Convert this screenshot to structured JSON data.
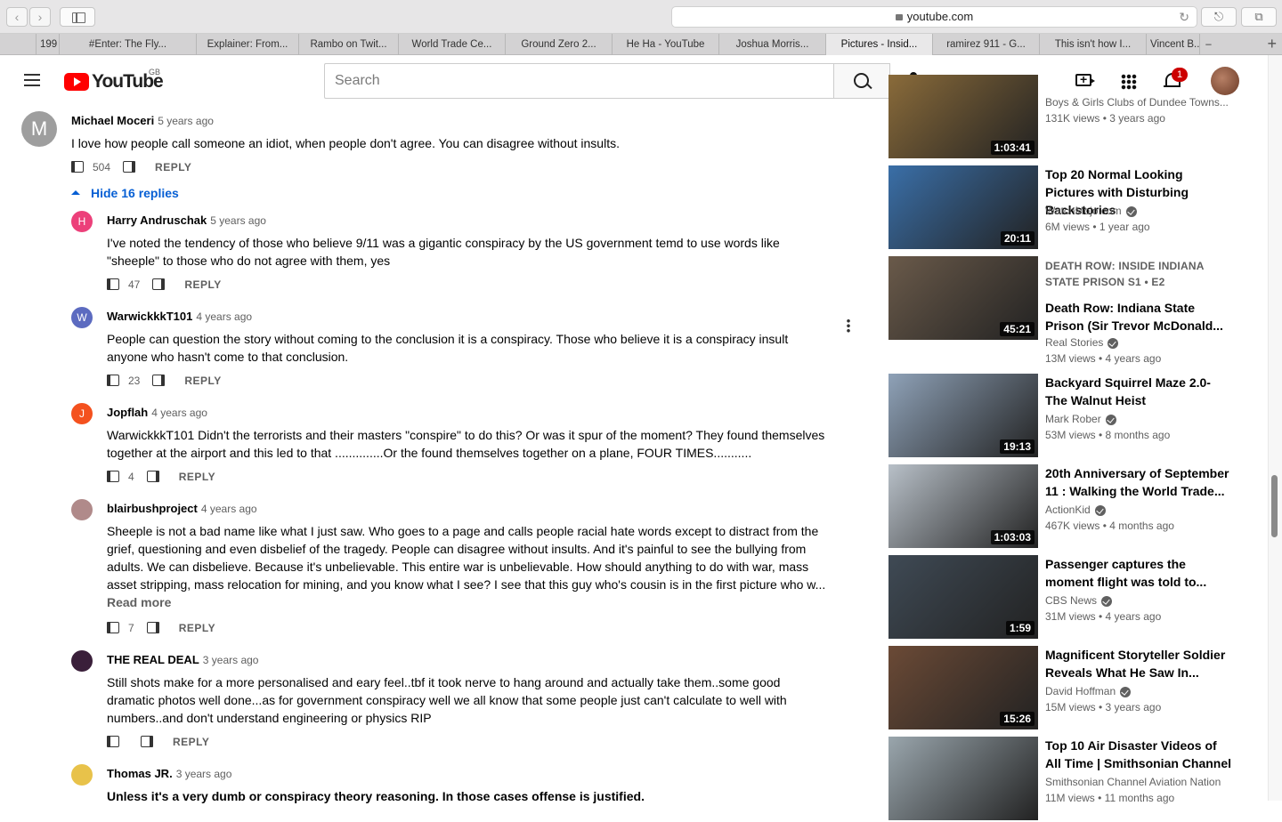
{
  "browser": {
    "url": "youtube.com",
    "tabs": [
      "199",
      "#Enter: The Fly...",
      "Explainer: From...",
      "Rambo on Twit...",
      "World Trade Ce...",
      "Ground Zero 2...",
      "He Ha - YouTube",
      "Joshua Morris...",
      "Pictures - Insid...",
      "ramirez 911 - G...",
      "This isn't how I...",
      "Vincent B...",
      "–"
    ]
  },
  "header": {
    "logo": "YouTube",
    "country": "GB",
    "search_placeholder": "Search",
    "notifications": "1"
  },
  "comments": [
    {
      "author": "Michael Moceri",
      "time": "5 years ago",
      "initial": "M",
      "avatar_color": "#9e9e9e",
      "text": "I love how people call someone an idiot, when people don't agree. You can disagree without insults.",
      "likes": "504",
      "reply": "REPLY"
    },
    {
      "author": "Harry Andruschak",
      "time": "5 years ago",
      "initial": "H",
      "avatar_color": "#ec407a",
      "text": "I've noted the tendency of those who believe 9/11 was a gigantic conspiracy by the US government temd to use words like \"sheeple\" to those who do not agree with them, yes",
      "likes": "47",
      "reply": "REPLY"
    },
    {
      "author": "WarwickkkT101",
      "time": "4 years ago",
      "initial": "W",
      "avatar_color": "#5c6bc0",
      "text": "People can question the story without coming to the conclusion it is a conspiracy. Those who believe it is a conspiracy insult anyone who hasn't come to that conclusion.",
      "likes": "23",
      "reply": "REPLY"
    },
    {
      "author": "Jopflah",
      "time": "4 years ago",
      "initial": "J",
      "avatar_color": "#f4511e",
      "text": "WarwickkkT101 Didn't the terrorists and their masters \"conspire\" to do this? Or was it spur of the moment? They found themselves together at the airport and this led to that ..............Or the found themselves together on a plane, FOUR TIMES...........",
      "likes": "4",
      "reply": "REPLY"
    },
    {
      "author": "blairbushproject",
      "time": "4 years ago",
      "initial": "",
      "avatar_color": "#b08a8a",
      "text": "Sheeple is not a bad name like what I just saw. Who goes to a page and calls people racial hate words except to distract from the grief, questioning and even disbelief of the tragedy. People can disagree without insults. And it's painful to see the bullying from adults. We can disbelieve. Because it's unbelievable. This entire war is unbelievable. How should anything to do with war, mass asset stripping, mass relocation for mining, and you know what I see?  I see that this guy who's cousin is in the first picture who w...",
      "likes": "7",
      "reply": "REPLY",
      "read_more": "Read more"
    },
    {
      "author": "THE REAL DEAL",
      "time": "3 years ago",
      "initial": "",
      "avatar_color": "#3a1f3a",
      "text": "Still shots make for a more personalised and eary feel..tbf it took nerve to hang around and actually take them..some good dramatic photos well done...as for government conspiracy well we all know that some people just can't calculate to well with numbers..and don't understand engineering or physics RIP",
      "likes": "",
      "reply": "REPLY"
    },
    {
      "author": "Thomas JR.",
      "time": "3 years ago",
      "initial": "",
      "avatar_color": "#e8c24a",
      "text": "Unless it's a very dumb or conspiracy theory reasoning. In those cases offense is justified.",
      "likes": "",
      "reply": ""
    }
  ],
  "hide_replies": "Hide 16 replies",
  "sidebar": [
    {
      "title": "",
      "channel": "Boys & Girls Clubs of Dundee Towns...",
      "meta": "131K views • 3 years ago",
      "duration": "1:03:41",
      "thumb": "#8a6b3a"
    },
    {
      "title": "Top 20 Normal Looking Pictures with Disturbing Backstories",
      "channel": "WatchMojo.com",
      "meta": "6M views • 1 year ago",
      "duration": "20:11",
      "thumb": "#3a6fa8"
    },
    {
      "title": "Death Row: Indiana State Prison (Sir Trevor McDonald...",
      "kicker": "DEATH ROW: INSIDE INDIANA STATE PRISON  S1 • E2",
      "channel": "Real Stories",
      "meta": "13M views • 4 years ago",
      "duration": "45:21",
      "thumb": "#6a5a4a"
    },
    {
      "title": "Backyard Squirrel Maze 2.0- The Walnut Heist",
      "channel": "Mark Rober",
      "meta": "53M views • 8 months ago",
      "duration": "19:13",
      "thumb": "#8fa2b8"
    },
    {
      "title": "20th Anniversary of September 11 : Walking the World Trade...",
      "channel": "ActionKid",
      "meta": "467K views • 4 months ago",
      "duration": "1:03:03",
      "thumb": "#b8c0c8"
    },
    {
      "title": "Passenger captures the moment flight was told to...",
      "channel": "CBS News",
      "meta": "31M views • 4 years ago",
      "duration": "1:59",
      "thumb": "#3f4a55"
    },
    {
      "title": "Magnificent Storyteller Soldier Reveals What He Saw In...",
      "channel": "David Hoffman",
      "meta": "15M views • 3 years ago",
      "duration": "15:26",
      "thumb": "#6b4a36"
    },
    {
      "title": "Top 10 Air Disaster Videos of All Time | Smithsonian Channel",
      "channel": "Smithsonian Channel Aviation Nation",
      "meta": "11M views • 11 months ago",
      "duration": "",
      "thumb": "#9aa6ad"
    }
  ]
}
